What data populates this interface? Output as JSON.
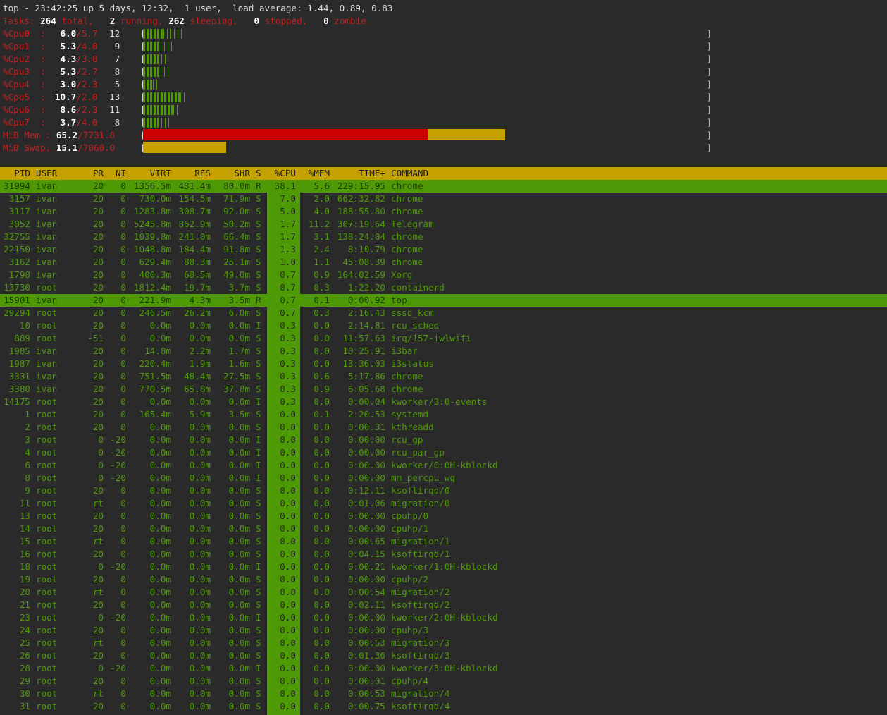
{
  "summary": {
    "line1": "top - 23:42:25 up 5 days, 12:32,  1 user,  load average: 1.44, 0.89, 0.83",
    "tasks_label": "Tasks:",
    "tasks_total": "264",
    "total_label": "total,",
    "tasks_running": "2",
    "running_label": "running,",
    "tasks_sleeping": "262",
    "sleeping_label": "sleeping,",
    "tasks_stopped": "0",
    "stopped_label": "stopped,",
    "tasks_zombie": "0",
    "zombie_label": "zombie"
  },
  "cpus": [
    {
      "label": "%Cpu0  :",
      "pct": "6.0",
      "avg": "/5.7",
      "count": "12",
      "fill": 0.06,
      "ticks": 0.115
    },
    {
      "label": "%Cpu1  :",
      "pct": "5.3",
      "avg": "/4.0",
      "count": "9",
      "fill": 0.053,
      "ticks": 0.09
    },
    {
      "label": "%Cpu2  :",
      "pct": "4.3",
      "avg": "/3.0",
      "count": "7",
      "fill": 0.043,
      "ticks": 0.068
    },
    {
      "label": "%Cpu3  :",
      "pct": "5.3",
      "avg": "/2.7",
      "count": "8",
      "fill": 0.053,
      "ticks": 0.08
    },
    {
      "label": "%Cpu4  :",
      "pct": "3.0",
      "avg": "/2.3",
      "count": "5",
      "fill": 0.03,
      "ticks": 0.05
    },
    {
      "label": "%Cpu5  :",
      "pct": "10.7",
      "avg": "/2.0",
      "count": "13",
      "fill": 0.11,
      "ticks": 0.125
    },
    {
      "label": "%Cpu6  :",
      "pct": "8.6",
      "avg": "/2.3",
      "count": "11",
      "fill": 0.09,
      "ticks": 0.108
    },
    {
      "label": "%Cpu7  :",
      "pct": "3.7",
      "avg": "/4.0",
      "count": "8",
      "fill": 0.043,
      "ticks": 0.078
    }
  ],
  "memory": {
    "mem_label": "MiB Mem :",
    "mem_pct": "65.2",
    "mem_total": "/7731.8",
    "mem_used_frac": 0.505,
    "mem_buff_frac": 0.138,
    "swap_label": "MiB Swap:",
    "swap_pct": "15.1",
    "swap_total": "/7860.0",
    "swap_frac": 0.148,
    "bracket_l": "[",
    "bracket_r": "]"
  },
  "colors": {
    "background": "#2a2a2a",
    "accent_green": "#4e9a06",
    "header_yellow": "#c4a000",
    "mem_red": "#cc0000",
    "label_red": "#c71f1f"
  },
  "columns": {
    "pid": "PID",
    "user": "USER",
    "pr": "PR",
    "ni": "NI",
    "virt": "VIRT",
    "res": "RES",
    "shr": "SHR",
    "s": "S",
    "cpu": "%CPU",
    "mem": "%MEM",
    "time": "TIME+",
    "command": "COMMAND"
  },
  "processes": [
    {
      "pid": "31994",
      "user": "ivan",
      "pr": "20",
      "ni": "0",
      "virt": "1356.5m",
      "res": "431.4m",
      "shr": "80.0m",
      "s": "R",
      "cpu": "38.1",
      "mem": "5.6",
      "time": "229:15.95",
      "cmd": "chrome",
      "hl": true
    },
    {
      "pid": "3157",
      "user": "ivan",
      "pr": "20",
      "ni": "0",
      "virt": "730.0m",
      "res": "154.5m",
      "shr": "71.9m",
      "s": "S",
      "cpu": "7.0",
      "mem": "2.0",
      "time": "662:32.82",
      "cmd": "chrome"
    },
    {
      "pid": "3117",
      "user": "ivan",
      "pr": "20",
      "ni": "0",
      "virt": "1283.8m",
      "res": "308.7m",
      "shr": "92.0m",
      "s": "S",
      "cpu": "5.0",
      "mem": "4.0",
      "time": "188:55.80",
      "cmd": "chrome"
    },
    {
      "pid": "3052",
      "user": "ivan",
      "pr": "20",
      "ni": "0",
      "virt": "5245.8m",
      "res": "862.9m",
      "shr": "50.2m",
      "s": "S",
      "cpu": "1.7",
      "mem": "11.2",
      "time": "307:19.64",
      "cmd": "Telegram"
    },
    {
      "pid": "32755",
      "user": "ivan",
      "pr": "20",
      "ni": "0",
      "virt": "1039.8m",
      "res": "241.0m",
      "shr": "66.4m",
      "s": "S",
      "cpu": "1.7",
      "mem": "3.1",
      "time": "138:24.04",
      "cmd": "chrome"
    },
    {
      "pid": "22150",
      "user": "ivan",
      "pr": "20",
      "ni": "0",
      "virt": "1048.8m",
      "res": "184.4m",
      "shr": "91.8m",
      "s": "S",
      "cpu": "1.3",
      "mem": "2.4",
      "time": "8:10.79",
      "cmd": "chrome"
    },
    {
      "pid": "3162",
      "user": "ivan",
      "pr": "20",
      "ni": "0",
      "virt": "629.4m",
      "res": "88.3m",
      "shr": "25.1m",
      "s": "S",
      "cpu": "1.0",
      "mem": "1.1",
      "time": "45:08.39",
      "cmd": "chrome"
    },
    {
      "pid": "1798",
      "user": "ivan",
      "pr": "20",
      "ni": "0",
      "virt": "400.3m",
      "res": "68.5m",
      "shr": "49.0m",
      "s": "S",
      "cpu": "0.7",
      "mem": "0.9",
      "time": "164:02.59",
      "cmd": "Xorg"
    },
    {
      "pid": "13730",
      "user": "root",
      "pr": "20",
      "ni": "0",
      "virt": "1812.4m",
      "res": "19.7m",
      "shr": "3.7m",
      "s": "S",
      "cpu": "0.7",
      "mem": "0.3",
      "time": "1:22.20",
      "cmd": "containerd"
    },
    {
      "pid": "15901",
      "user": "ivan",
      "pr": "20",
      "ni": "0",
      "virt": "221.9m",
      "res": "4.3m",
      "shr": "3.5m",
      "s": "R",
      "cpu": "0.7",
      "mem": "0.1",
      "time": "0:00.92",
      "cmd": "top",
      "hl": true
    },
    {
      "pid": "29294",
      "user": "root",
      "pr": "20",
      "ni": "0",
      "virt": "246.5m",
      "res": "26.2m",
      "shr": "6.0m",
      "s": "S",
      "cpu": "0.7",
      "mem": "0.3",
      "time": "2:16.43",
      "cmd": "sssd_kcm"
    },
    {
      "pid": "10",
      "user": "root",
      "pr": "20",
      "ni": "0",
      "virt": "0.0m",
      "res": "0.0m",
      "shr": "0.0m",
      "s": "I",
      "cpu": "0.3",
      "mem": "0.0",
      "time": "2:14.81",
      "cmd": "rcu_sched"
    },
    {
      "pid": "889",
      "user": "root",
      "pr": "-51",
      "ni": "0",
      "virt": "0.0m",
      "res": "0.0m",
      "shr": "0.0m",
      "s": "S",
      "cpu": "0.3",
      "mem": "0.0",
      "time": "11:57.63",
      "cmd": "irq/157-iwlwifi"
    },
    {
      "pid": "1985",
      "user": "ivan",
      "pr": "20",
      "ni": "0",
      "virt": "14.8m",
      "res": "2.2m",
      "shr": "1.7m",
      "s": "S",
      "cpu": "0.3",
      "mem": "0.0",
      "time": "10:25.91",
      "cmd": "i3bar"
    },
    {
      "pid": "1987",
      "user": "ivan",
      "pr": "20",
      "ni": "0",
      "virt": "220.4m",
      "res": "1.9m",
      "shr": "1.6m",
      "s": "S",
      "cpu": "0.3",
      "mem": "0.0",
      "time": "13:36.03",
      "cmd": "i3status"
    },
    {
      "pid": "3331",
      "user": "ivan",
      "pr": "20",
      "ni": "0",
      "virt": "751.5m",
      "res": "48.4m",
      "shr": "27.5m",
      "s": "S",
      "cpu": "0.3",
      "mem": "0.6",
      "time": "5:17.86",
      "cmd": "chrome"
    },
    {
      "pid": "3380",
      "user": "ivan",
      "pr": "20",
      "ni": "0",
      "virt": "770.5m",
      "res": "65.8m",
      "shr": "37.8m",
      "s": "S",
      "cpu": "0.3",
      "mem": "0.9",
      "time": "6:05.68",
      "cmd": "chrome"
    },
    {
      "pid": "14175",
      "user": "root",
      "pr": "20",
      "ni": "0",
      "virt": "0.0m",
      "res": "0.0m",
      "shr": "0.0m",
      "s": "I",
      "cpu": "0.3",
      "mem": "0.0",
      "time": "0:00.04",
      "cmd": "kworker/3:0-events"
    },
    {
      "pid": "1",
      "user": "root",
      "pr": "20",
      "ni": "0",
      "virt": "165.4m",
      "res": "5.9m",
      "shr": "3.5m",
      "s": "S",
      "cpu": "0.0",
      "mem": "0.1",
      "time": "2:20.53",
      "cmd": "systemd"
    },
    {
      "pid": "2",
      "user": "root",
      "pr": "20",
      "ni": "0",
      "virt": "0.0m",
      "res": "0.0m",
      "shr": "0.0m",
      "s": "S",
      "cpu": "0.0",
      "mem": "0.0",
      "time": "0:00.31",
      "cmd": "kthreadd"
    },
    {
      "pid": "3",
      "user": "root",
      "pr": "0",
      "ni": "-20",
      "virt": "0.0m",
      "res": "0.0m",
      "shr": "0.0m",
      "s": "I",
      "cpu": "0.0",
      "mem": "0.0",
      "time": "0:00.00",
      "cmd": "rcu_gp"
    },
    {
      "pid": "4",
      "user": "root",
      "pr": "0",
      "ni": "-20",
      "virt": "0.0m",
      "res": "0.0m",
      "shr": "0.0m",
      "s": "I",
      "cpu": "0.0",
      "mem": "0.0",
      "time": "0:00.00",
      "cmd": "rcu_par_gp"
    },
    {
      "pid": "6",
      "user": "root",
      "pr": "0",
      "ni": "-20",
      "virt": "0.0m",
      "res": "0.0m",
      "shr": "0.0m",
      "s": "I",
      "cpu": "0.0",
      "mem": "0.0",
      "time": "0:00.00",
      "cmd": "kworker/0:0H-kblockd"
    },
    {
      "pid": "8",
      "user": "root",
      "pr": "0",
      "ni": "-20",
      "virt": "0.0m",
      "res": "0.0m",
      "shr": "0.0m",
      "s": "I",
      "cpu": "0.0",
      "mem": "0.0",
      "time": "0:00.00",
      "cmd": "mm_percpu_wq"
    },
    {
      "pid": "9",
      "user": "root",
      "pr": "20",
      "ni": "0",
      "virt": "0.0m",
      "res": "0.0m",
      "shr": "0.0m",
      "s": "S",
      "cpu": "0.0",
      "mem": "0.0",
      "time": "0:12.11",
      "cmd": "ksoftirqd/0"
    },
    {
      "pid": "11",
      "user": "root",
      "pr": "rt",
      "ni": "0",
      "virt": "0.0m",
      "res": "0.0m",
      "shr": "0.0m",
      "s": "S",
      "cpu": "0.0",
      "mem": "0.0",
      "time": "0:01.06",
      "cmd": "migration/0"
    },
    {
      "pid": "13",
      "user": "root",
      "pr": "20",
      "ni": "0",
      "virt": "0.0m",
      "res": "0.0m",
      "shr": "0.0m",
      "s": "S",
      "cpu": "0.0",
      "mem": "0.0",
      "time": "0:00.00",
      "cmd": "cpuhp/0"
    },
    {
      "pid": "14",
      "user": "root",
      "pr": "20",
      "ni": "0",
      "virt": "0.0m",
      "res": "0.0m",
      "shr": "0.0m",
      "s": "S",
      "cpu": "0.0",
      "mem": "0.0",
      "time": "0:00.00",
      "cmd": "cpuhp/1"
    },
    {
      "pid": "15",
      "user": "root",
      "pr": "rt",
      "ni": "0",
      "virt": "0.0m",
      "res": "0.0m",
      "shr": "0.0m",
      "s": "S",
      "cpu": "0.0",
      "mem": "0.0",
      "time": "0:00.65",
      "cmd": "migration/1"
    },
    {
      "pid": "16",
      "user": "root",
      "pr": "20",
      "ni": "0",
      "virt": "0.0m",
      "res": "0.0m",
      "shr": "0.0m",
      "s": "S",
      "cpu": "0.0",
      "mem": "0.0",
      "time": "0:04.15",
      "cmd": "ksoftirqd/1"
    },
    {
      "pid": "18",
      "user": "root",
      "pr": "0",
      "ni": "-20",
      "virt": "0.0m",
      "res": "0.0m",
      "shr": "0.0m",
      "s": "I",
      "cpu": "0.0",
      "mem": "0.0",
      "time": "0:00.21",
      "cmd": "kworker/1:0H-kblockd"
    },
    {
      "pid": "19",
      "user": "root",
      "pr": "20",
      "ni": "0",
      "virt": "0.0m",
      "res": "0.0m",
      "shr": "0.0m",
      "s": "S",
      "cpu": "0.0",
      "mem": "0.0",
      "time": "0:00.00",
      "cmd": "cpuhp/2"
    },
    {
      "pid": "20",
      "user": "root",
      "pr": "rt",
      "ni": "0",
      "virt": "0.0m",
      "res": "0.0m",
      "shr": "0.0m",
      "s": "S",
      "cpu": "0.0",
      "mem": "0.0",
      "time": "0:00.54",
      "cmd": "migration/2"
    },
    {
      "pid": "21",
      "user": "root",
      "pr": "20",
      "ni": "0",
      "virt": "0.0m",
      "res": "0.0m",
      "shr": "0.0m",
      "s": "S",
      "cpu": "0.0",
      "mem": "0.0",
      "time": "0:02.11",
      "cmd": "ksoftirqd/2"
    },
    {
      "pid": "23",
      "user": "root",
      "pr": "0",
      "ni": "-20",
      "virt": "0.0m",
      "res": "0.0m",
      "shr": "0.0m",
      "s": "I",
      "cpu": "0.0",
      "mem": "0.0",
      "time": "0:00.00",
      "cmd": "kworker/2:0H-kblockd"
    },
    {
      "pid": "24",
      "user": "root",
      "pr": "20",
      "ni": "0",
      "virt": "0.0m",
      "res": "0.0m",
      "shr": "0.0m",
      "s": "S",
      "cpu": "0.0",
      "mem": "0.0",
      "time": "0:00.00",
      "cmd": "cpuhp/3"
    },
    {
      "pid": "25",
      "user": "root",
      "pr": "rt",
      "ni": "0",
      "virt": "0.0m",
      "res": "0.0m",
      "shr": "0.0m",
      "s": "S",
      "cpu": "0.0",
      "mem": "0.0",
      "time": "0:00.53",
      "cmd": "migration/3"
    },
    {
      "pid": "26",
      "user": "root",
      "pr": "20",
      "ni": "0",
      "virt": "0.0m",
      "res": "0.0m",
      "shr": "0.0m",
      "s": "S",
      "cpu": "0.0",
      "mem": "0.0",
      "time": "0:01.36",
      "cmd": "ksoftirqd/3"
    },
    {
      "pid": "28",
      "user": "root",
      "pr": "0",
      "ni": "-20",
      "virt": "0.0m",
      "res": "0.0m",
      "shr": "0.0m",
      "s": "I",
      "cpu": "0.0",
      "mem": "0.0",
      "time": "0:00.00",
      "cmd": "kworker/3:0H-kblockd"
    },
    {
      "pid": "29",
      "user": "root",
      "pr": "20",
      "ni": "0",
      "virt": "0.0m",
      "res": "0.0m",
      "shr": "0.0m",
      "s": "S",
      "cpu": "0.0",
      "mem": "0.0",
      "time": "0:00.01",
      "cmd": "cpuhp/4"
    },
    {
      "pid": "30",
      "user": "root",
      "pr": "rt",
      "ni": "0",
      "virt": "0.0m",
      "res": "0.0m",
      "shr": "0.0m",
      "s": "S",
      "cpu": "0.0",
      "mem": "0.0",
      "time": "0:00.53",
      "cmd": "migration/4"
    },
    {
      "pid": "31",
      "user": "root",
      "pr": "20",
      "ni": "0",
      "virt": "0.0m",
      "res": "0.0m",
      "shr": "0.0m",
      "s": "S",
      "cpu": "0.0",
      "mem": "0.0",
      "time": "0:00.75",
      "cmd": "ksoftirqd/4"
    }
  ]
}
